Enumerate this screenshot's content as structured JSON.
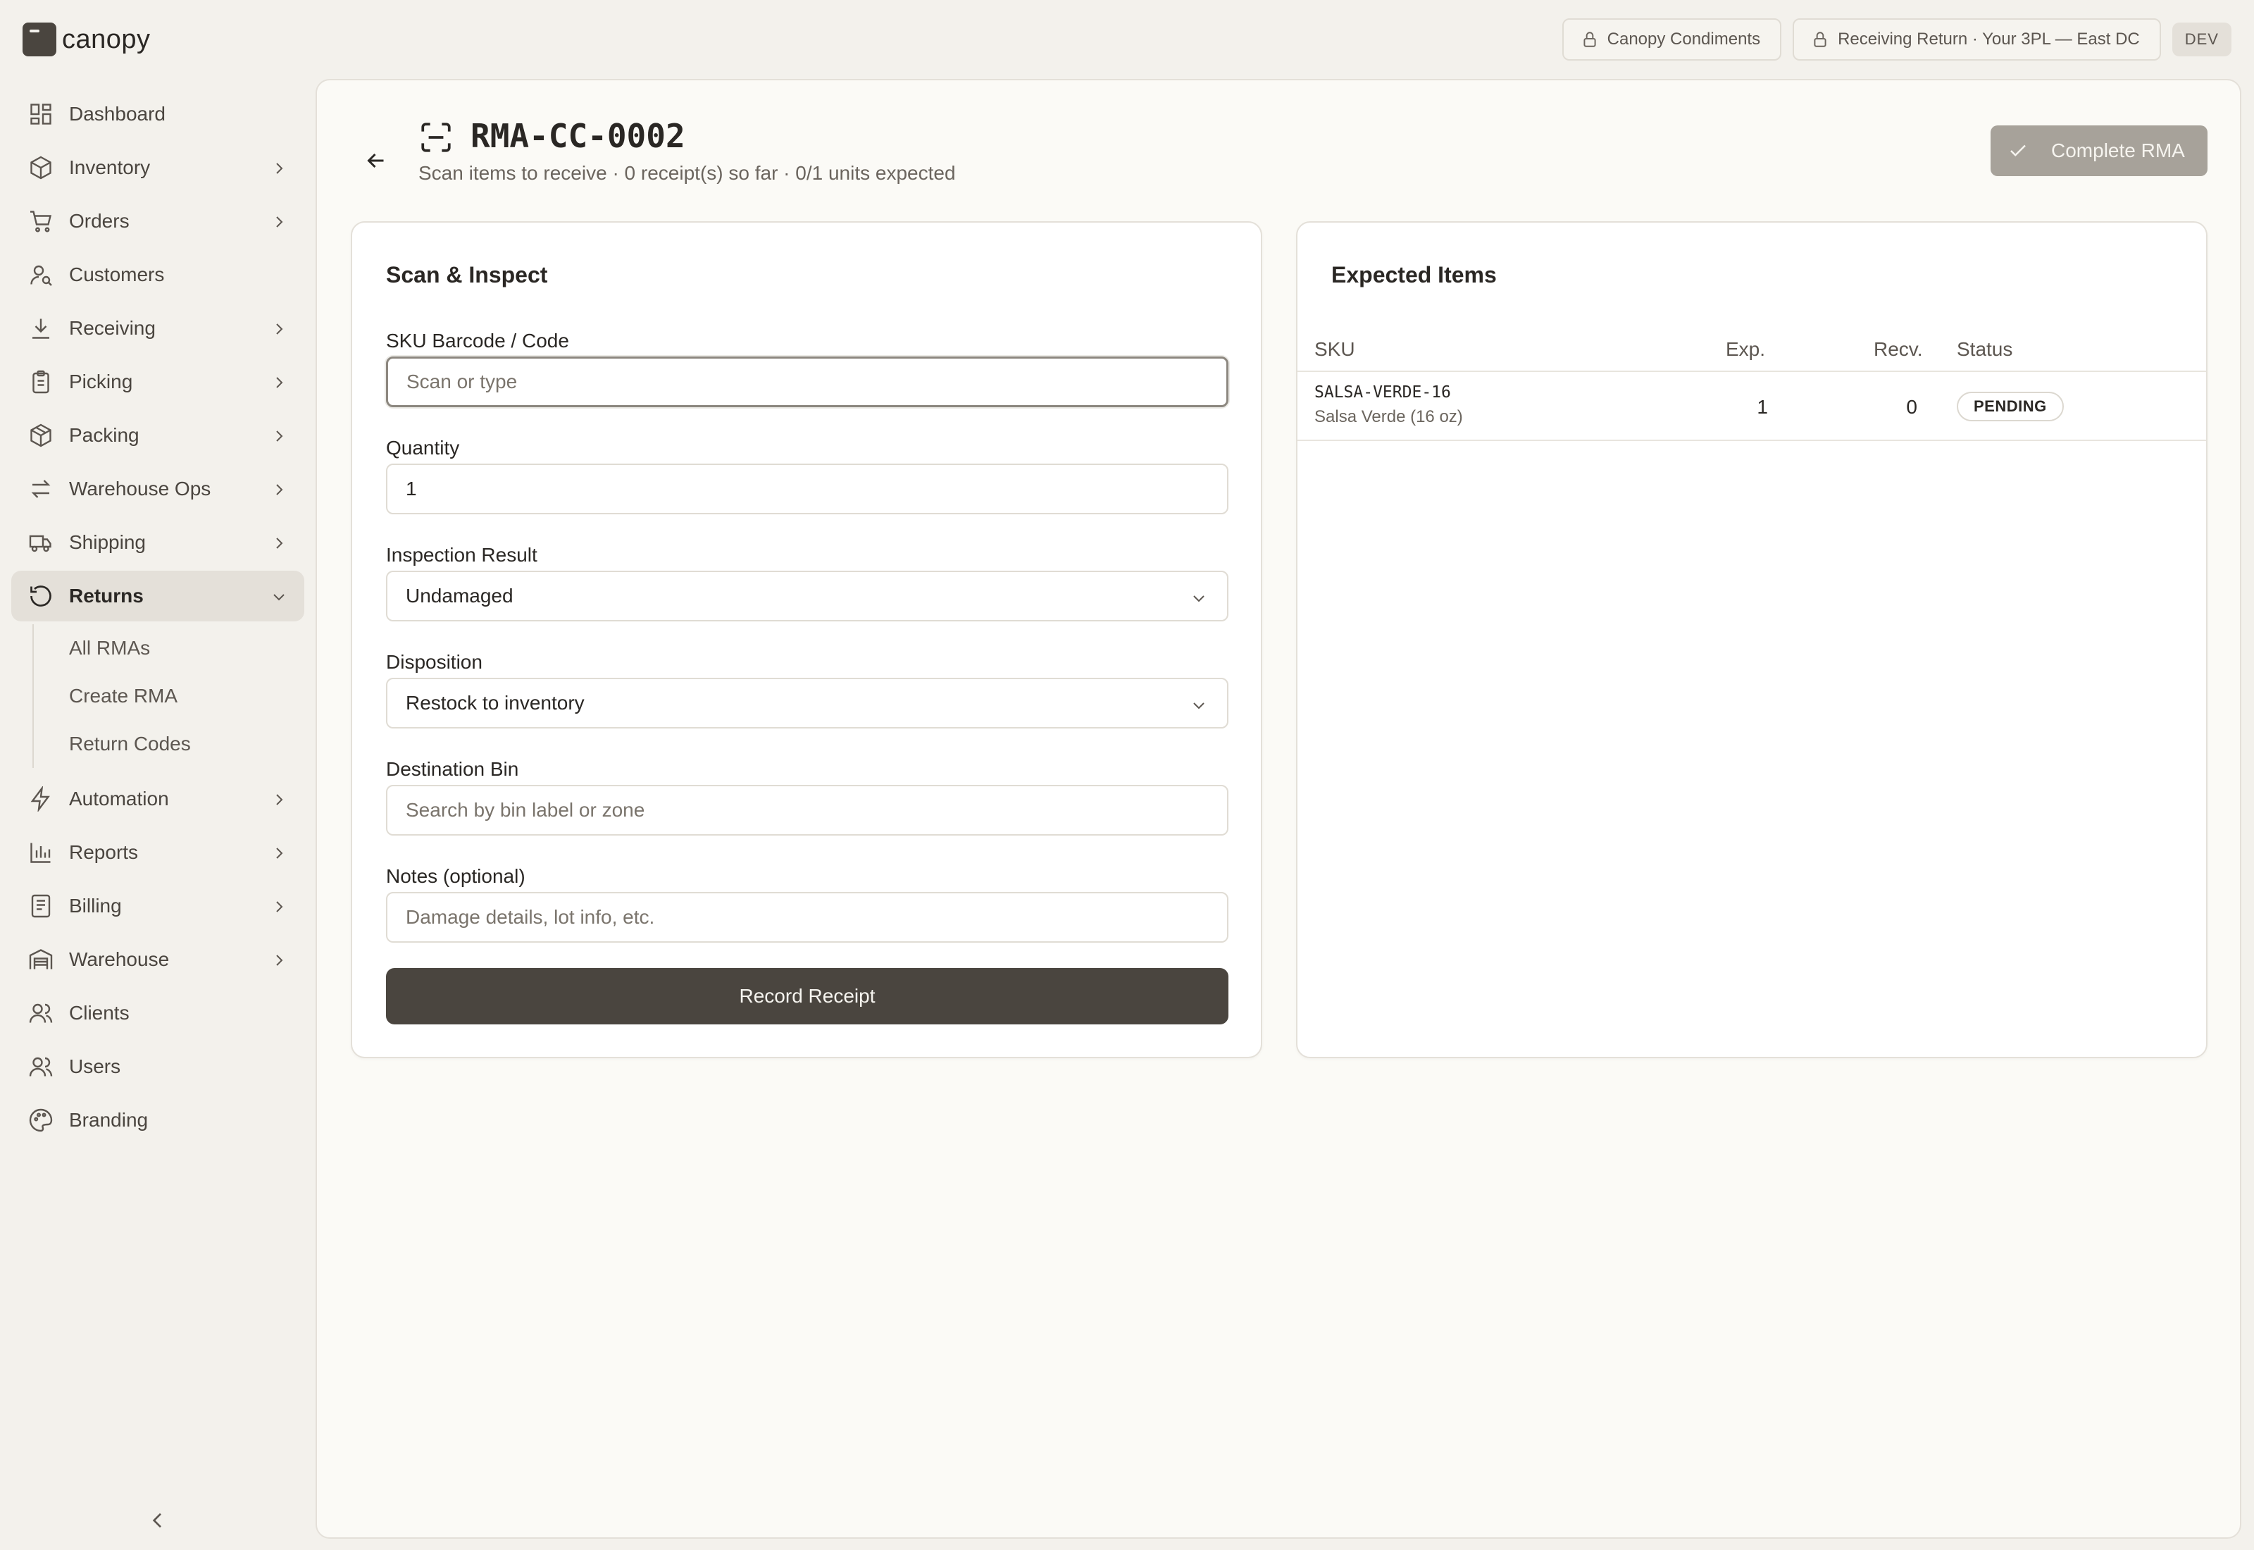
{
  "app": {
    "logo_text": "canopy"
  },
  "topbar": {
    "client_pill": "Canopy Condiments",
    "context_pill": "Receiving Return · Your 3PL — East DC",
    "env_badge": "DEV"
  },
  "sidebar": {
    "items": [
      {
        "label": "Dashboard",
        "icon": "dashboard-icon"
      },
      {
        "label": "Inventory",
        "icon": "box-icon"
      },
      {
        "label": "Orders",
        "icon": "cart-icon"
      },
      {
        "label": "Customers",
        "icon": "customer-icon"
      },
      {
        "label": "Receiving",
        "icon": "download-icon"
      },
      {
        "label": "Picking",
        "icon": "clipboard-icon"
      },
      {
        "label": "Packing",
        "icon": "package-icon"
      },
      {
        "label": "Warehouse Ops",
        "icon": "arrows-icon"
      },
      {
        "label": "Shipping",
        "icon": "truck-icon"
      },
      {
        "label": "Returns",
        "icon": "rotate-icon"
      },
      {
        "label": "Automation",
        "icon": "bolt-icon"
      },
      {
        "label": "Reports",
        "icon": "chart-icon"
      },
      {
        "label": "Billing",
        "icon": "receipt-icon"
      },
      {
        "label": "Warehouse",
        "icon": "warehouse-icon"
      },
      {
        "label": "Clients",
        "icon": "clients-icon"
      },
      {
        "label": "Users",
        "icon": "users-icon"
      },
      {
        "label": "Branding",
        "icon": "palette-icon"
      }
    ],
    "returns_sub": [
      "All RMAs",
      "Create RMA",
      "Return Codes"
    ]
  },
  "header": {
    "title": "RMA-CC-0002",
    "subtitle": "Scan items to receive · 0 receipt(s) so far · 0/1 units expected",
    "complete_label": "Complete RMA"
  },
  "scan_form": {
    "title": "Scan & Inspect",
    "sku_label": "SKU Barcode / Code",
    "sku_placeholder": "Scan or type",
    "qty_label": "Quantity",
    "qty_value": "1",
    "inspection_label": "Inspection Result",
    "inspection_value": "Undamaged",
    "disposition_label": "Disposition",
    "disposition_value": "Restock to inventory",
    "bin_label": "Destination Bin",
    "bin_placeholder": "Search by bin label or zone",
    "notes_label": "Notes (optional)",
    "notes_placeholder": "Damage details, lot info, etc.",
    "submit_label": "Record Receipt"
  },
  "expected": {
    "title": "Expected Items",
    "columns": {
      "sku": "SKU",
      "exp": "Exp.",
      "recv": "Recv.",
      "status": "Status"
    },
    "rows": [
      {
        "sku": "SALSA-VERDE-16",
        "name": "Salsa Verde (16 oz)",
        "exp": "1",
        "recv": "0",
        "status": "PENDING"
      }
    ]
  }
}
